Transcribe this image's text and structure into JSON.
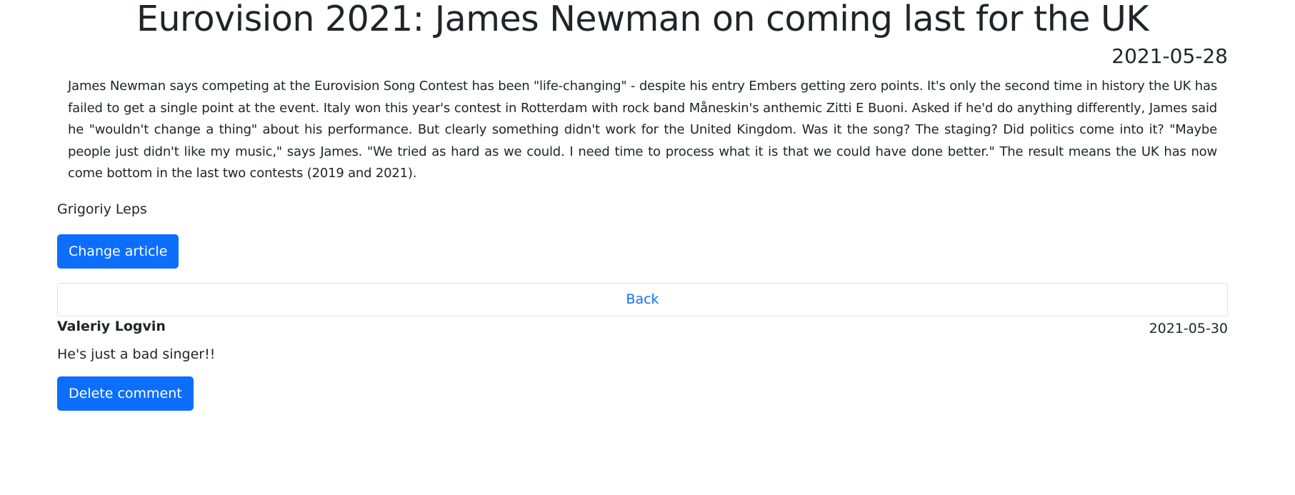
{
  "article": {
    "title": "Eurovision 2021: James Newman on coming last for the UK",
    "date": "2021-05-28",
    "text": "James Newman says competing at the Eurovision Song Contest has been \"life-changing\" - despite his entry Embers getting zero points. It's only the second time in history the UK has failed to get a single point at the event. Italy won this year's contest in Rotterdam with rock band Måneskin's anthemic Zitti E Buoni. Asked if he'd do anything differently, James said he \"wouldn't change a thing\" about his performance. But clearly something didn't work for the United Kingdom. Was it the song? The staging? Did politics come into it? \"Maybe people just didn't like my music,\" says James. \"We tried as hard as we could. I need time to process what it is that we could have done better.\" The result means the UK has now come bottom in the last two contests (2019 and 2021).",
    "author": "Grigoriy Leps",
    "change_button": "Change article"
  },
  "nav": {
    "back_label": "Back"
  },
  "comment": {
    "author": "Valeriy Logvin",
    "date": "2021-05-30",
    "text": "He's just a bad singer!!",
    "delete_button": "Delete comment"
  }
}
